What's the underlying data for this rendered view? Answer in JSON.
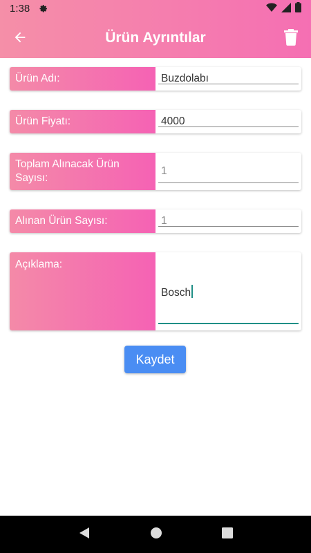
{
  "status_bar": {
    "time": "1:38",
    "icons": [
      "gear-icon",
      "wifi-icon",
      "signal-icon",
      "battery-icon"
    ]
  },
  "app_bar": {
    "title": "Ürün Ayrıntılar",
    "back_icon": "arrow-left-icon",
    "delete_icon": "trash-icon",
    "colors": {
      "gradient_start": "#f58fa8",
      "gradient_end": "#f56fb3"
    }
  },
  "form": {
    "fields": [
      {
        "label": "Ürün Adı:",
        "value": "Buzdolabı"
      },
      {
        "label": "Ürün Fiyatı:",
        "value": "4000"
      },
      {
        "label": "Toplam Alınacak Ürün Sayısı:",
        "value": "1"
      },
      {
        "label": "Alınan Ürün Sayısı:",
        "value": "1"
      },
      {
        "label": "Açıklama:",
        "value": "Bosch"
      }
    ]
  },
  "save_button": {
    "label": "Kaydet",
    "color": "#4a8df3"
  },
  "nav_bar": {
    "icons": [
      "back-triangle-icon",
      "home-circle-icon",
      "recents-square-icon"
    ]
  }
}
